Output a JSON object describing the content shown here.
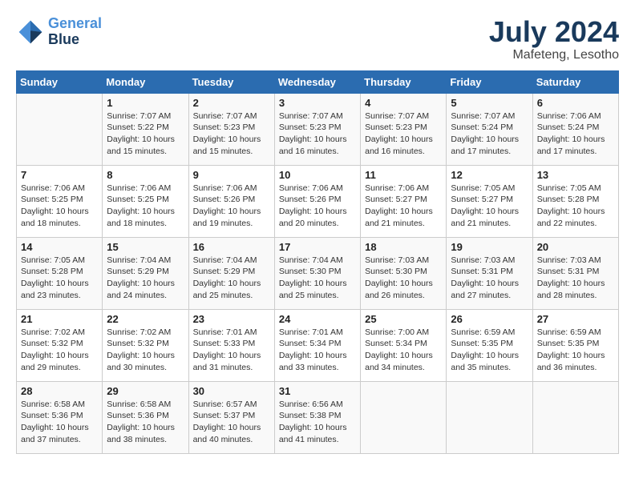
{
  "logo": {
    "line1": "General",
    "line2": "Blue"
  },
  "title": {
    "month_year": "July 2024",
    "location": "Mafeteng, Lesotho"
  },
  "headers": [
    "Sunday",
    "Monday",
    "Tuesday",
    "Wednesday",
    "Thursday",
    "Friday",
    "Saturday"
  ],
  "weeks": [
    [
      null,
      {
        "day": "1",
        "sunrise": "7:07 AM",
        "sunset": "5:22 PM",
        "daylight": "10 hours and 15 minutes."
      },
      {
        "day": "2",
        "sunrise": "7:07 AM",
        "sunset": "5:23 PM",
        "daylight": "10 hours and 15 minutes."
      },
      {
        "day": "3",
        "sunrise": "7:07 AM",
        "sunset": "5:23 PM",
        "daylight": "10 hours and 16 minutes."
      },
      {
        "day": "4",
        "sunrise": "7:07 AM",
        "sunset": "5:23 PM",
        "daylight": "10 hours and 16 minutes."
      },
      {
        "day": "5",
        "sunrise": "7:07 AM",
        "sunset": "5:24 PM",
        "daylight": "10 hours and 17 minutes."
      },
      {
        "day": "6",
        "sunrise": "7:06 AM",
        "sunset": "5:24 PM",
        "daylight": "10 hours and 17 minutes."
      }
    ],
    [
      {
        "day": "7",
        "sunrise": "7:06 AM",
        "sunset": "5:25 PM",
        "daylight": "10 hours and 18 minutes."
      },
      {
        "day": "8",
        "sunrise": "7:06 AM",
        "sunset": "5:25 PM",
        "daylight": "10 hours and 18 minutes."
      },
      {
        "day": "9",
        "sunrise": "7:06 AM",
        "sunset": "5:26 PM",
        "daylight": "10 hours and 19 minutes."
      },
      {
        "day": "10",
        "sunrise": "7:06 AM",
        "sunset": "5:26 PM",
        "daylight": "10 hours and 20 minutes."
      },
      {
        "day": "11",
        "sunrise": "7:06 AM",
        "sunset": "5:27 PM",
        "daylight": "10 hours and 21 minutes."
      },
      {
        "day": "12",
        "sunrise": "7:05 AM",
        "sunset": "5:27 PM",
        "daylight": "10 hours and 21 minutes."
      },
      {
        "day": "13",
        "sunrise": "7:05 AM",
        "sunset": "5:28 PM",
        "daylight": "10 hours and 22 minutes."
      }
    ],
    [
      {
        "day": "14",
        "sunrise": "7:05 AM",
        "sunset": "5:28 PM",
        "daylight": "10 hours and 23 minutes."
      },
      {
        "day": "15",
        "sunrise": "7:04 AM",
        "sunset": "5:29 PM",
        "daylight": "10 hours and 24 minutes."
      },
      {
        "day": "16",
        "sunrise": "7:04 AM",
        "sunset": "5:29 PM",
        "daylight": "10 hours and 25 minutes."
      },
      {
        "day": "17",
        "sunrise": "7:04 AM",
        "sunset": "5:30 PM",
        "daylight": "10 hours and 25 minutes."
      },
      {
        "day": "18",
        "sunrise": "7:03 AM",
        "sunset": "5:30 PM",
        "daylight": "10 hours and 26 minutes."
      },
      {
        "day": "19",
        "sunrise": "7:03 AM",
        "sunset": "5:31 PM",
        "daylight": "10 hours and 27 minutes."
      },
      {
        "day": "20",
        "sunrise": "7:03 AM",
        "sunset": "5:31 PM",
        "daylight": "10 hours and 28 minutes."
      }
    ],
    [
      {
        "day": "21",
        "sunrise": "7:02 AM",
        "sunset": "5:32 PM",
        "daylight": "10 hours and 29 minutes."
      },
      {
        "day": "22",
        "sunrise": "7:02 AM",
        "sunset": "5:32 PM",
        "daylight": "10 hours and 30 minutes."
      },
      {
        "day": "23",
        "sunrise": "7:01 AM",
        "sunset": "5:33 PM",
        "daylight": "10 hours and 31 minutes."
      },
      {
        "day": "24",
        "sunrise": "7:01 AM",
        "sunset": "5:34 PM",
        "daylight": "10 hours and 33 minutes."
      },
      {
        "day": "25",
        "sunrise": "7:00 AM",
        "sunset": "5:34 PM",
        "daylight": "10 hours and 34 minutes."
      },
      {
        "day": "26",
        "sunrise": "6:59 AM",
        "sunset": "5:35 PM",
        "daylight": "10 hours and 35 minutes."
      },
      {
        "day": "27",
        "sunrise": "6:59 AM",
        "sunset": "5:35 PM",
        "daylight": "10 hours and 36 minutes."
      }
    ],
    [
      {
        "day": "28",
        "sunrise": "6:58 AM",
        "sunset": "5:36 PM",
        "daylight": "10 hours and 37 minutes."
      },
      {
        "day": "29",
        "sunrise": "6:58 AM",
        "sunset": "5:36 PM",
        "daylight": "10 hours and 38 minutes."
      },
      {
        "day": "30",
        "sunrise": "6:57 AM",
        "sunset": "5:37 PM",
        "daylight": "10 hours and 40 minutes."
      },
      {
        "day": "31",
        "sunrise": "6:56 AM",
        "sunset": "5:38 PM",
        "daylight": "10 hours and 41 minutes."
      },
      null,
      null,
      null
    ]
  ]
}
